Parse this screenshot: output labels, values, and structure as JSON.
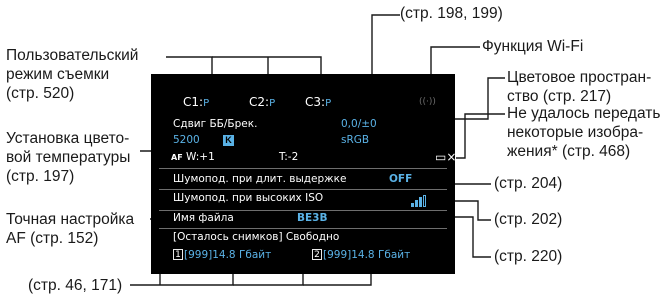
{
  "callouts": {
    "top_page": "(стр. 198, 199)",
    "wifi": "Функция Wi-Fi",
    "custom_mode": [
      "Пользовательский",
      "режим съемки",
      "(стр. 520)"
    ],
    "color_space": [
      "Цветовое простран-",
      "ство (стр. 217)"
    ],
    "transfer_fail": [
      "Не удалось передать",
      "некоторые изобра-",
      "жения* (стр. 468)"
    ],
    "color_temp": [
      "Установка цвето-",
      "вой температуры",
      "(стр. 197)"
    ],
    "nr_long": "(стр. 204)",
    "nr_iso": "(стр. 202)",
    "af_micro": [
      "Точная настройка",
      "AF (стр. 152)"
    ],
    "file_name": "(стр. 220)",
    "cards": "(стр. 46, 171)"
  },
  "screen": {
    "custom_modes": [
      {
        "label": "C1",
        "value": "P"
      },
      {
        "label": "C2",
        "value": "P"
      },
      {
        "label": "C3",
        "value": "P"
      }
    ],
    "wifi_indicator": "((·))",
    "wb_shift_label": "Сдвиг ББ/Брек.",
    "wb_shift_value": "0,0/±0",
    "color_temp_value": "5200",
    "color_temp_unit": "K",
    "color_space_value": "sRGB",
    "af_micro_symbol": "AF",
    "af_micro_w": "W:+1",
    "af_micro_t": "T:-2",
    "transfer_fail_icon": "▭×",
    "nr_long_label": "Шумопод. при длит. выдержке",
    "nr_long_value": "OFF",
    "nr_iso_label": "Шумопод. при высоких ISO",
    "file_name_label": "Имя файла",
    "file_name_value": "BE3B",
    "remaining_label": "[Осталось снимков] Свободно",
    "card1": {
      "num": "1",
      "shots": "[999]",
      "free": "14.8 Гбайт"
    },
    "card2": {
      "num": "2",
      "shots": "[999]",
      "free": "14.8 Гбайт"
    }
  },
  "colors": {
    "screen_bg": "#000000",
    "accent_blue": "#5ab2e6",
    "text_white": "#ffffff",
    "leader": "#1a1a1a"
  }
}
